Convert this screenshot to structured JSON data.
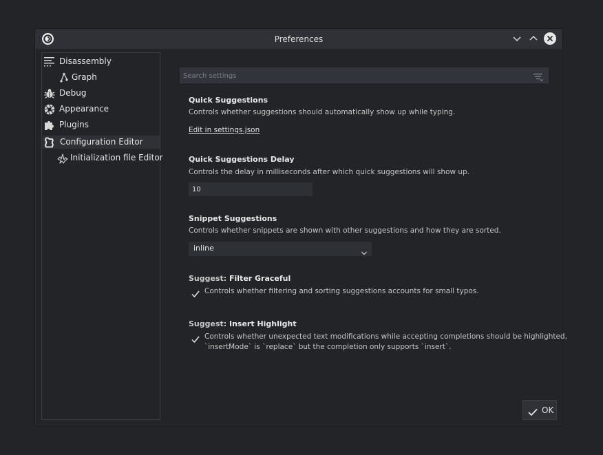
{
  "window": {
    "title": "Preferences"
  },
  "sidebar": {
    "items": [
      {
        "label": "Disassembly",
        "icon": "disassembly-icon"
      },
      {
        "label": "Graph",
        "icon": "graph-icon"
      },
      {
        "label": "Debug",
        "icon": "bug-icon"
      },
      {
        "label": "Appearance",
        "icon": "aperture-icon"
      },
      {
        "label": "Plugins",
        "icon": "puzzle-icon"
      },
      {
        "label": "Configuration Editor",
        "icon": "config-editor-icon",
        "selected": true
      },
      {
        "label": "Initialization file Editor",
        "icon": "init-file-icon"
      }
    ]
  },
  "search": {
    "placeholder": "Search settings",
    "value": ""
  },
  "settings": {
    "quick_suggestions": {
      "title": "Quick Suggestions",
      "description": "Controls whether suggestions should automatically show up while typing.",
      "link": "Edit in settings.json"
    },
    "quick_suggestions_delay": {
      "title": "Quick Suggestions Delay",
      "description": "Controls the delay in milliseconds after which quick suggestions will show up.",
      "value": "10"
    },
    "snippet_suggestions": {
      "title": "Snippet Suggestions",
      "description": "Controls whether snippets are shown with other suggestions and how they are sorted.",
      "value": "inline"
    },
    "filter_graceful": {
      "prefix": "Suggest: ",
      "title": "Filter Graceful",
      "description": "Controls whether filtering and sorting suggestions accounts for small typos.",
      "checked": true
    },
    "insert_highlight": {
      "prefix": "Suggest: ",
      "title": "Insert Highlight",
      "description_line1": "Controls whether unexpected text modifications while accepting completions should be highlighted,",
      "description_line2": "`insertMode` is `replace` but the completion only supports `insert`.",
      "checked": true
    }
  },
  "footer": {
    "ok_label": "OK"
  },
  "colors": {
    "background": "#222428",
    "titlebar": "#2f3136",
    "input_bg": "#2d3035",
    "text": "#e3e3e3"
  }
}
